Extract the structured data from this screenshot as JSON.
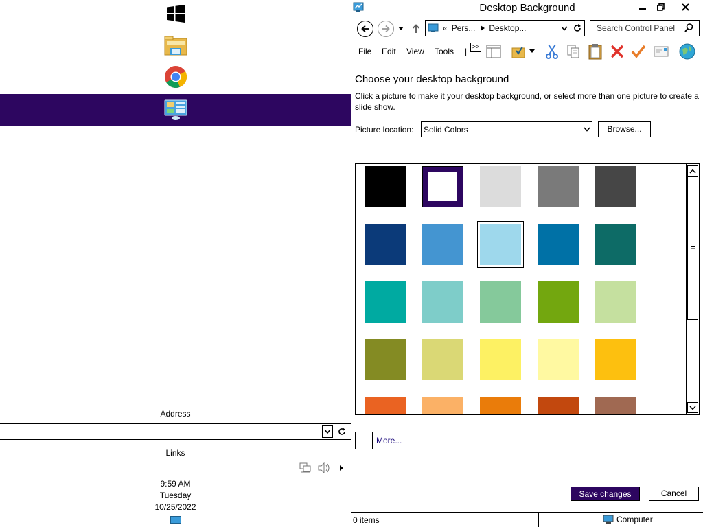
{
  "taskbar": {
    "address_label": "Address",
    "links_label": "Links",
    "clock": {
      "time": "9:59 AM",
      "day": "Tuesday",
      "date": "10/25/2022"
    }
  },
  "window": {
    "title": "Desktop Background",
    "breadcrumb": {
      "overflow": "«",
      "segments": [
        "Pers...",
        "Desktop..."
      ]
    },
    "search": {
      "placeholder": "Search Control Panel"
    },
    "menu": {
      "file": "File",
      "edit": "Edit",
      "view": "View",
      "tools": "Tools",
      "separator": "|",
      "more": ">>"
    },
    "heading": "Choose your desktop background",
    "description": "Click a picture to make it your desktop background, or select more than one picture to create a slide show.",
    "picture_location": {
      "label": "Picture location:",
      "value": "Solid Colors",
      "browse": "Browse..."
    },
    "colors": [
      [
        "#000000",
        "#ffffff",
        "#dcdcdc",
        "#7a7a7a",
        "#464646"
      ],
      [
        "#0b3a79",
        "#4495d1",
        "#9ed8ec",
        "#0071a6",
        "#0d6b66"
      ],
      [
        "#00aaa1",
        "#7ecdc9",
        "#85c99b",
        "#73a70f",
        "#c5e09f"
      ],
      [
        "#848b23",
        "#dad875",
        "#fdf163",
        "#fff9a1",
        "#fdc00f"
      ],
      [
        "#ea6322",
        "#fbb166",
        "#ea7c0a",
        "#c2480e",
        "#a06952"
      ]
    ],
    "current_color": "#ffffff",
    "focused_color": "#9ed8ec",
    "more_link": "More...",
    "buttons": {
      "save": "Save changes",
      "cancel": "Cancel"
    },
    "status": {
      "items": "0 items",
      "zone": "Computer"
    }
  },
  "colors": {
    "accent": "#2d0660",
    "link": "#1b0a7c"
  }
}
